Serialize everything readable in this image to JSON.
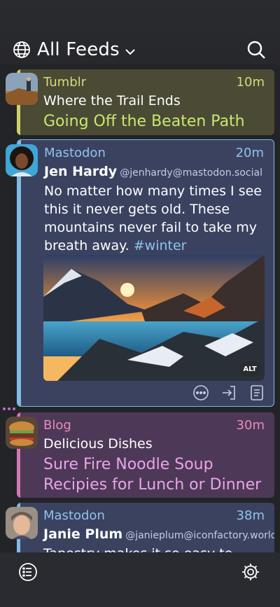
{
  "header": {
    "title": "All Feeds"
  },
  "feed": [
    {
      "source": "Tumblr",
      "time": "10m",
      "name": "Where the Trail Ends",
      "headline": "Going Off the Beaten Path"
    },
    {
      "source": "Mastodon",
      "time": "20m",
      "name": "Jen Hardy",
      "handle": "@jenhardy@mastodon.social",
      "body": "No matter how many times I see this it never gets old. These mountains never fail to take my breath away.",
      "hashtag": "#winter",
      "alt_badge": "ALT"
    },
    {
      "source": "Blog",
      "time": "30m",
      "name": "Delicious Dishes",
      "headline": "Sure Fire Noodle Soup Recipies for Lunch or Dinner"
    },
    {
      "source": "Mastodon",
      "time": "38m",
      "name": "Janie Plum",
      "handle": "@janieplum@iconfactory.world",
      "body": "Tapestry makes it so easy to follo"
    }
  ]
}
